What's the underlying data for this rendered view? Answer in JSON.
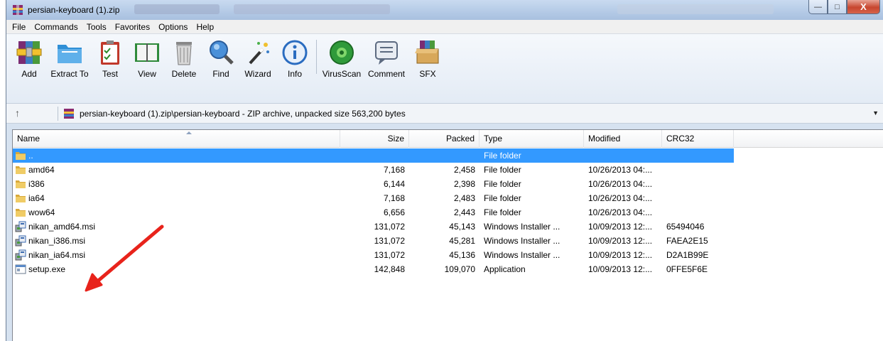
{
  "window": {
    "title": "persian-keyboard (1).zip",
    "controls": {
      "minimize": "—",
      "maximize": "□",
      "close": "X"
    }
  },
  "menu": [
    "File",
    "Commands",
    "Tools",
    "Favorites",
    "Options",
    "Help"
  ],
  "toolbar": [
    {
      "label": "Add",
      "icon": "add-archive-icon"
    },
    {
      "label": "Extract To",
      "icon": "extract-folder-icon"
    },
    {
      "label": "Test",
      "icon": "clipboard-check-icon"
    },
    {
      "label": "View",
      "icon": "book-icon"
    },
    {
      "label": "Delete",
      "icon": "trash-icon"
    },
    {
      "label": "Find",
      "icon": "magnifier-icon"
    },
    {
      "label": "Wizard",
      "icon": "magic-wand-icon"
    },
    {
      "label": "Info",
      "icon": "info-icon"
    },
    {
      "label": "VirusScan",
      "icon": "virus-scan-icon"
    },
    {
      "label": "Comment",
      "icon": "comment-icon"
    },
    {
      "label": "SFX",
      "icon": "sfx-box-icon"
    }
  ],
  "address": {
    "up_label": "↑",
    "path": "persian-keyboard (1).zip\\persian-keyboard - ZIP archive, unpacked size 563,200 bytes"
  },
  "columns": {
    "name": "Name",
    "size": "Size",
    "packed": "Packed",
    "type": "Type",
    "modified": "Modified",
    "crc": "CRC32"
  },
  "rows": [
    {
      "name": "..",
      "size": "",
      "packed": "",
      "type": "File folder",
      "modified": "",
      "crc": "",
      "icon": "folder-up-icon",
      "selected": true
    },
    {
      "name": "amd64",
      "size": "7,168",
      "packed": "2,458",
      "type": "File folder",
      "modified": "10/26/2013 04:...",
      "crc": "",
      "icon": "folder-icon"
    },
    {
      "name": "i386",
      "size": "6,144",
      "packed": "2,398",
      "type": "File folder",
      "modified": "10/26/2013 04:...",
      "crc": "",
      "icon": "folder-icon"
    },
    {
      "name": "ia64",
      "size": "7,168",
      "packed": "2,483",
      "type": "File folder",
      "modified": "10/26/2013 04:...",
      "crc": "",
      "icon": "folder-icon"
    },
    {
      "name": "wow64",
      "size": "6,656",
      "packed": "2,443",
      "type": "File folder",
      "modified": "10/26/2013 04:...",
      "crc": "",
      "icon": "folder-icon"
    },
    {
      "name": "nikan_amd64.msi",
      "size": "131,072",
      "packed": "45,143",
      "type": "Windows Installer ...",
      "modified": "10/09/2013 12:...",
      "crc": "65494046",
      "icon": "msi-icon"
    },
    {
      "name": "nikan_i386.msi",
      "size": "131,072",
      "packed": "45,281",
      "type": "Windows Installer ...",
      "modified": "10/09/2013 12:...",
      "crc": "FAEA2E15",
      "icon": "msi-icon"
    },
    {
      "name": "nikan_ia64.msi",
      "size": "131,072",
      "packed": "45,136",
      "type": "Windows Installer ...",
      "modified": "10/09/2013 12:...",
      "crc": "D2A1B99E",
      "icon": "msi-icon"
    },
    {
      "name": "setup.exe",
      "size": "142,848",
      "packed": "109,070",
      "type": "Application",
      "modified": "10/09/2013 12:...",
      "crc": "0FFE5F6E",
      "icon": "exe-icon"
    }
  ],
  "annotation": {
    "icon": "red-arrow-icon",
    "color": "#e8231b"
  },
  "colors": {
    "selection": "#3399ff",
    "titlebar": "#b4cae6",
    "folder": "#e8c35a"
  }
}
